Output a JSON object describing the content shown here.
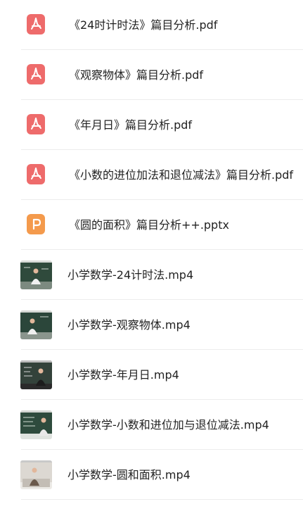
{
  "colors": {
    "pdf": "#ee6b6b",
    "ppt": "#f49a4c",
    "divider": "#ececec",
    "text": "#222222"
  },
  "files": [
    {
      "name": "《24时计时法》篇目分析.pdf",
      "kind": "pdf",
      "icon": "pdf-icon"
    },
    {
      "name": "《观察物体》篇目分析.pdf",
      "kind": "pdf",
      "icon": "pdf-icon"
    },
    {
      "name": "《年月日》篇目分析.pdf",
      "kind": "pdf",
      "icon": "pdf-icon"
    },
    {
      "name": "《小数的进位加法和退位减法》篇目分析.pdf",
      "kind": "pdf",
      "icon": "pdf-icon"
    },
    {
      "name": "《圆的面积》篇目分析++.pptx",
      "kind": "pptx",
      "icon": "ppt-icon"
    },
    {
      "name": "小学数学-24计时法.mp4",
      "kind": "mp4",
      "icon": "video-thumbnail"
    },
    {
      "name": "小学数学-观察物体.mp4",
      "kind": "mp4",
      "icon": "video-thumbnail"
    },
    {
      "name": "小学数学-年月日.mp4",
      "kind": "mp4",
      "icon": "video-thumbnail"
    },
    {
      "name": "小学数学-小数和进位加与退位减法.mp4",
      "kind": "mp4",
      "icon": "video-thumbnail"
    },
    {
      "name": "小学数学-圆和面积.mp4",
      "kind": "mp4",
      "icon": "video-thumbnail"
    }
  ]
}
